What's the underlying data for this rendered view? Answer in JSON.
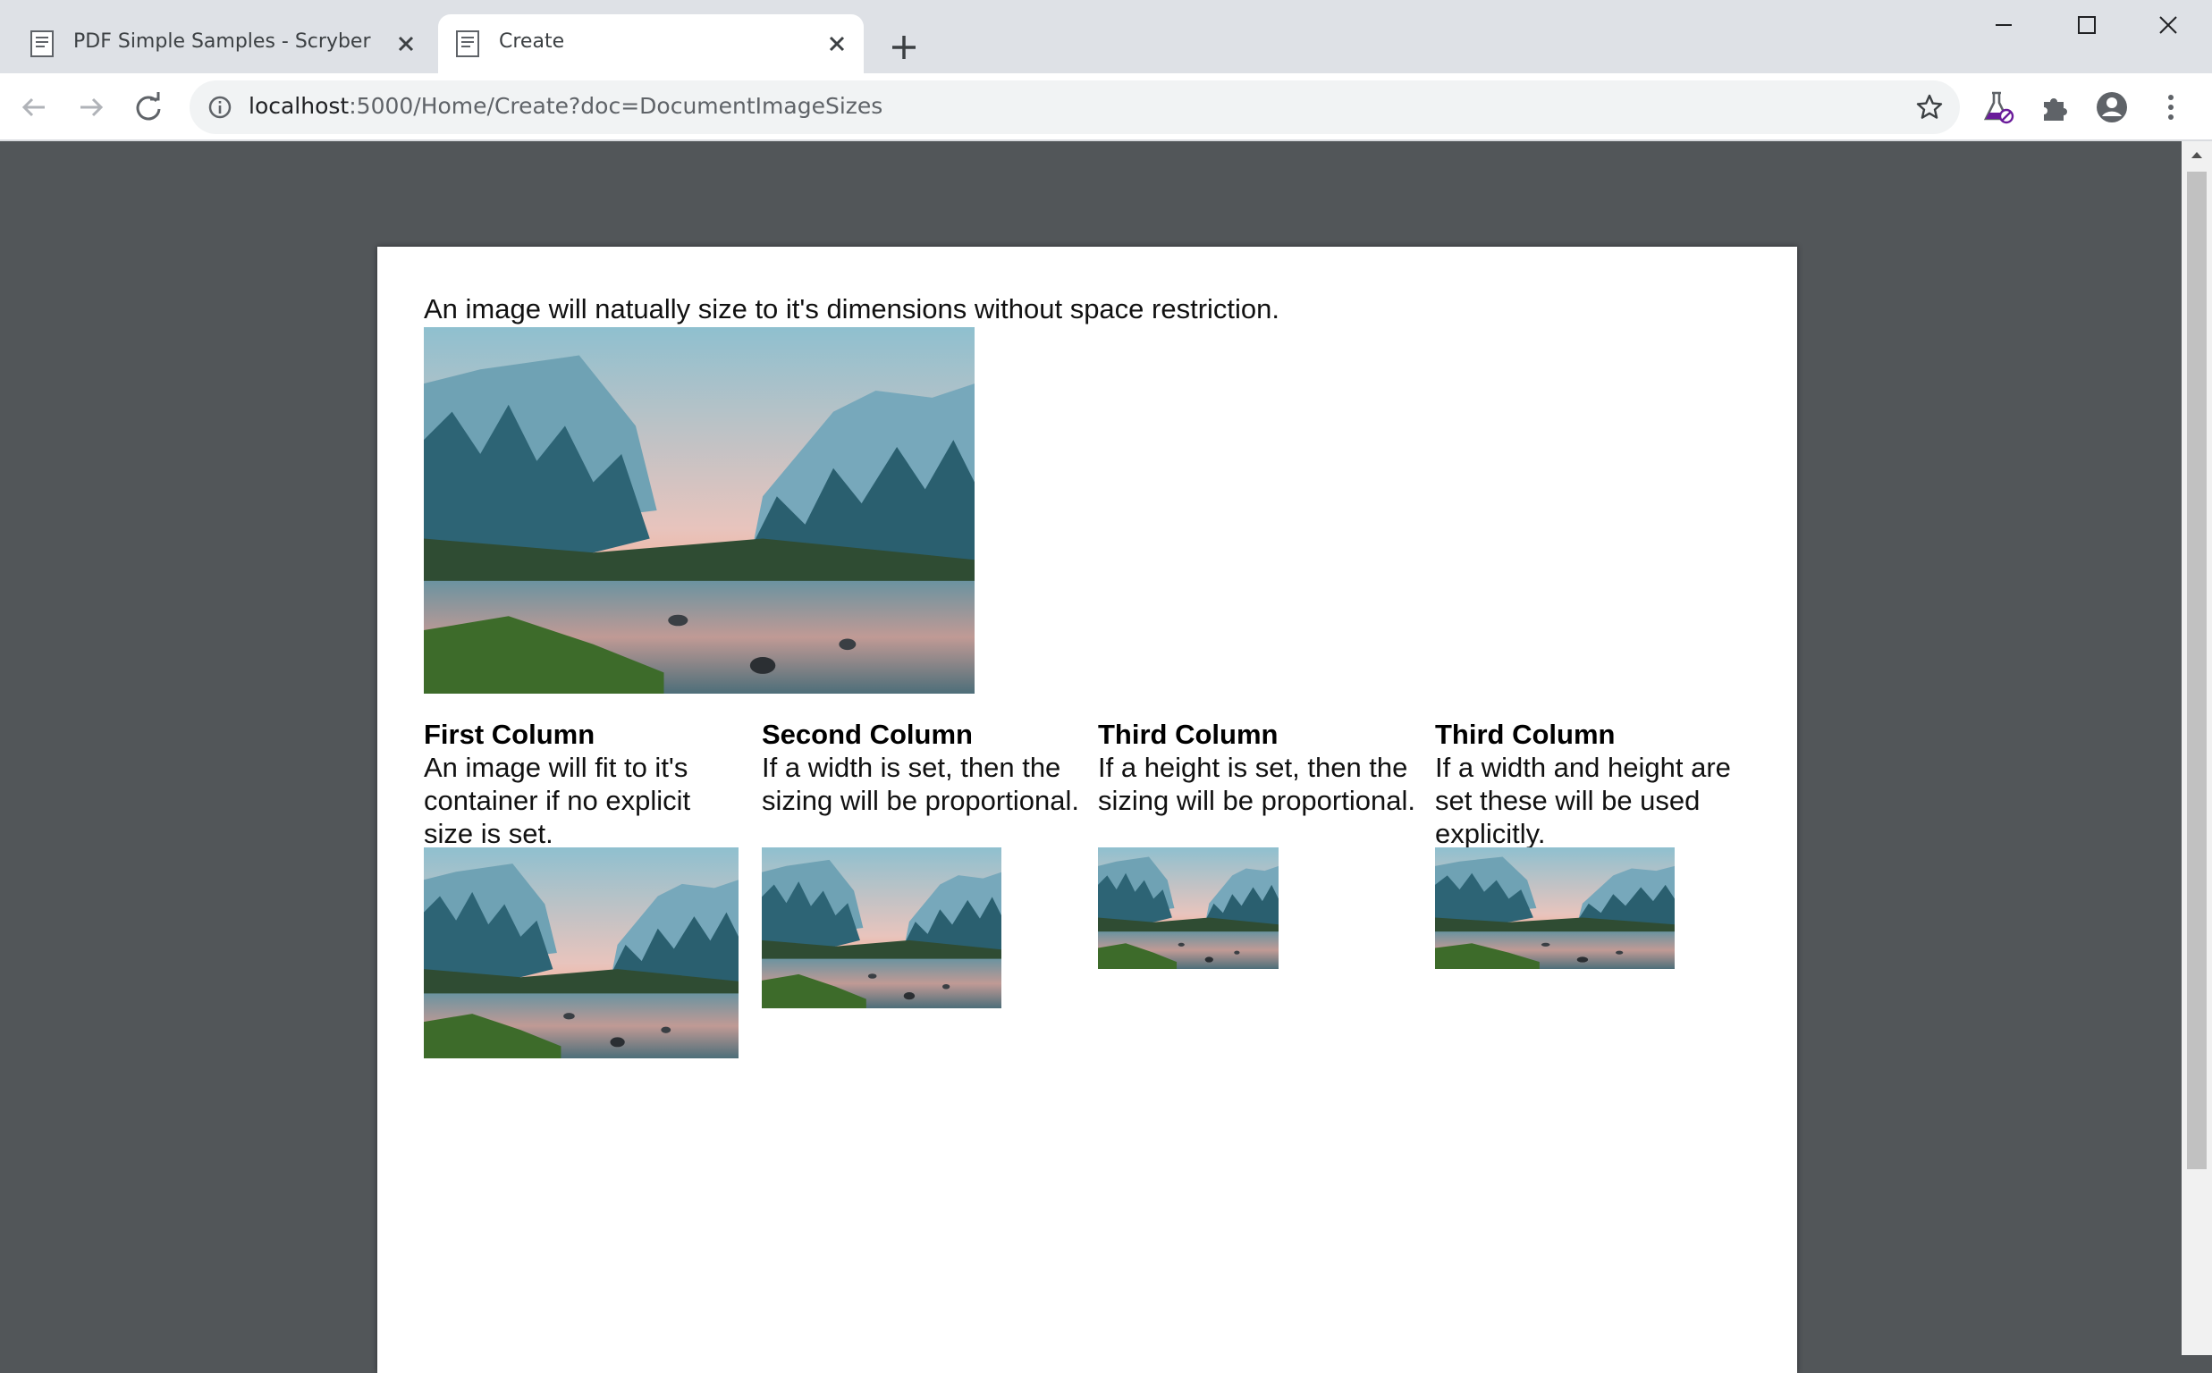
{
  "tabs": [
    {
      "title": "PDF Simple Samples - Scryber",
      "active": false
    },
    {
      "title": "Create",
      "active": true
    }
  ],
  "address": {
    "host": "localhost",
    "path": ":5000/Home/Create?doc=DocumentImageSizes"
  },
  "document": {
    "intro": "An image will natually size to it's dimensions without space restriction.",
    "columns": [
      {
        "heading": "First Column",
        "text": "An image will fit to it's container if no explicit size is set."
      },
      {
        "heading": "Second Column",
        "text": "If a width is set, then the sizing will be proportional."
      },
      {
        "heading": "Third Column",
        "text": "If a height is set, then the sizing will be proportional."
      },
      {
        "heading": "Third Column",
        "text": "If a width and height are set these will be used explicitly."
      }
    ]
  },
  "icons": {
    "back": "arrow-left-icon",
    "forward": "arrow-right-icon",
    "reload": "reload-icon",
    "info": "info-icon",
    "bookmark": "star-icon",
    "labs": "flask-icon",
    "extensions": "puzzle-icon",
    "profile": "account-icon",
    "menu": "kebab-menu-icon"
  },
  "colors": {
    "tabstrip": "#dee1e6",
    "viewer_bg": "#525659",
    "page_bg": "#ffffff"
  }
}
